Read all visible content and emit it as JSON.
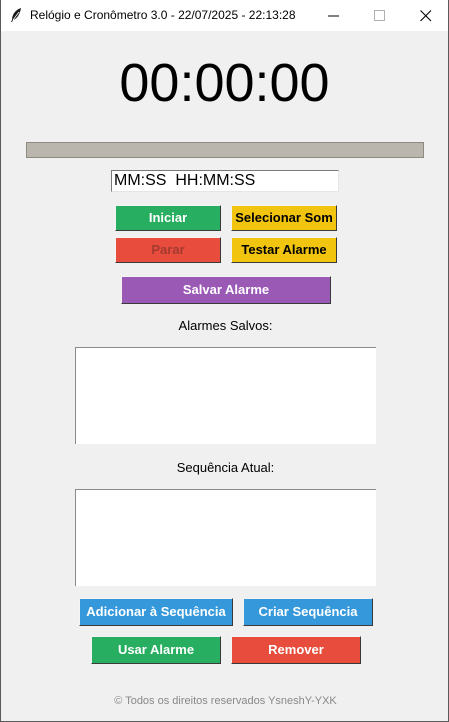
{
  "window": {
    "title": "Relógio e Cronômetro 3.0 - 22/07/2025 - 22:13:28",
    "icon": "feather-icon",
    "controls": [
      "minimize-icon",
      "maximize-icon",
      "close-icon"
    ]
  },
  "clock": {
    "display": "00:00:00"
  },
  "progress": {
    "value_percent": 0
  },
  "time_input": {
    "value": "MM:SS  HH:MM:SS"
  },
  "buttons": {
    "start": "Iniciar",
    "select_sound": "Selecionar Som",
    "stop": "Parar",
    "test_alarm": "Testar Alarme",
    "save_alarm": "Salvar Alarme",
    "add_to_sequence": "Adicionar à Sequência",
    "create_sequence": "Criar Sequência",
    "use_alarm": "Usar Alarme",
    "remove": "Remover"
  },
  "saved_alarms": {
    "label": "Alarmes Salvos:",
    "items": []
  },
  "current_sequence": {
    "label": "Sequência Atual:",
    "items": []
  },
  "footer": {
    "text": "© Todos os direitos reservados YsneshY-YXK"
  },
  "colors": {
    "green": "#27ae60",
    "red": "#e74c3c",
    "yellow": "#f1c40f",
    "purple": "#9b59b6",
    "blue": "#3498db",
    "background": "#f0f0f0"
  }
}
